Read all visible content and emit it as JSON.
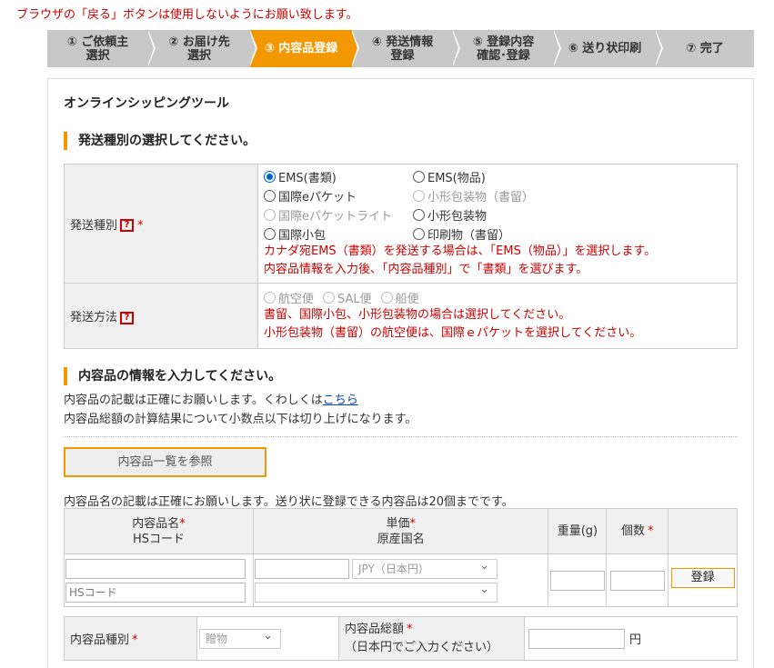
{
  "warning": "ブラウザの「戻る」ボタンは使用しないようにお願い致します。",
  "steps": [
    {
      "line1": "① ご依頼主",
      "line2": "選択",
      "active": false
    },
    {
      "line1": "② お届け先",
      "line2": "選択",
      "active": false
    },
    {
      "line1": "③ 内容品登録",
      "line2": "",
      "active": true
    },
    {
      "line1": "④ 発送情報",
      "line2": "登録",
      "active": false
    },
    {
      "line1": "⑤ 登録内容",
      "line2": "確認･登録",
      "active": false
    },
    {
      "line1": "⑥ 送り状印刷",
      "line2": "",
      "active": false
    },
    {
      "line1": "⑦ 完了",
      "line2": "",
      "active": false
    }
  ],
  "tool_title": "オンラインシッピングツール",
  "section1": "発送種別の選択してください。",
  "shipping_type": {
    "label": "発送種別",
    "help": "?",
    "required": "*",
    "options": [
      {
        "label": "EMS(書類)",
        "checked": true,
        "disabled": false
      },
      {
        "label": "EMS(物品)",
        "checked": false,
        "disabled": false
      },
      {
        "label": "国際eパケット",
        "checked": false,
        "disabled": false
      },
      {
        "label": "小形包装物（書留）",
        "checked": false,
        "disabled": true
      },
      {
        "label": "国際eパケットライト",
        "checked": false,
        "disabled": true
      },
      {
        "label": "小形包装物",
        "checked": false,
        "disabled": false
      },
      {
        "label": "国際小包",
        "checked": false,
        "disabled": false
      },
      {
        "label": "印刷物（書留）",
        "checked": false,
        "disabled": false
      }
    ],
    "note1": "カナダ宛EMS（書類）を発送する場合は、「EMS（物品）」を選択します。",
    "note2": "内容品情報を入力後、「内容品種別」で「書類」を選びます。"
  },
  "shipping_method": {
    "label": "発送方法",
    "help": "?",
    "options": [
      "航空便",
      "SAL便",
      "船便"
    ],
    "note1": "書留、国際小包、小形包装物の場合は選択してください。",
    "note2": "小形包装物（書留）の航空便は、国際ｅパケットを選択してください。"
  },
  "section2": "内容品の情報を入力してください。",
  "info_line1_prefix": "内容品の記載は正確にお願いします。くわしくは",
  "info_link": "こちら",
  "info_line2": "内容品総額の計算結果について小数点以下は切り上げになります。",
  "browse_button": "内容品一覧を参照",
  "items_note": "内容品名の記載は正確にお願いします。送り状に登録できる内容品は20個までです。",
  "items_table": {
    "col1_line1": "内容品名",
    "col1_line2": "HSコード",
    "col2_line1": "単価",
    "col2_line2": "原産国名",
    "col3": "重量(g)",
    "col4": "個数",
    "required": "*",
    "name_value": "",
    "hs_placeholder": "HSコード",
    "price_value": "",
    "currency": "JPY（日本円）",
    "origin": "",
    "weight_value": "",
    "qty_value": "",
    "register_button": "登録"
  },
  "bottom": {
    "type_label": "内容品種別",
    "type_value": "贈物",
    "total_label_line1": "内容品総額",
    "total_label_line2": "（日本円でご入力ください）",
    "required": "*",
    "total_value": "",
    "unit": "円"
  }
}
